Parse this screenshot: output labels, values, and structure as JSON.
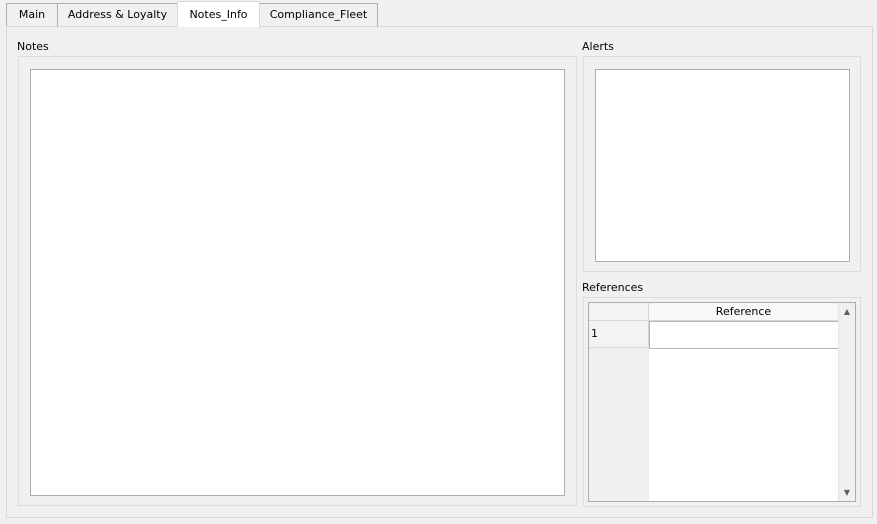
{
  "tabs": [
    {
      "label": "Main"
    },
    {
      "label": "Address & Loyalty"
    },
    {
      "label": "Notes_Info"
    },
    {
      "label": "Compliance_Fleet"
    }
  ],
  "active_tab": "Notes_Info",
  "notes": {
    "label": "Notes",
    "value": ""
  },
  "alerts": {
    "label": "Alerts",
    "value": ""
  },
  "references": {
    "label": "References",
    "column_header": "Reference",
    "rows": [
      {
        "row_number": "1",
        "reference": ""
      }
    ]
  },
  "icons": {
    "scroll_up": "scroll-up-arrow-icon",
    "scroll_down": "scroll-down-arrow-icon"
  }
}
